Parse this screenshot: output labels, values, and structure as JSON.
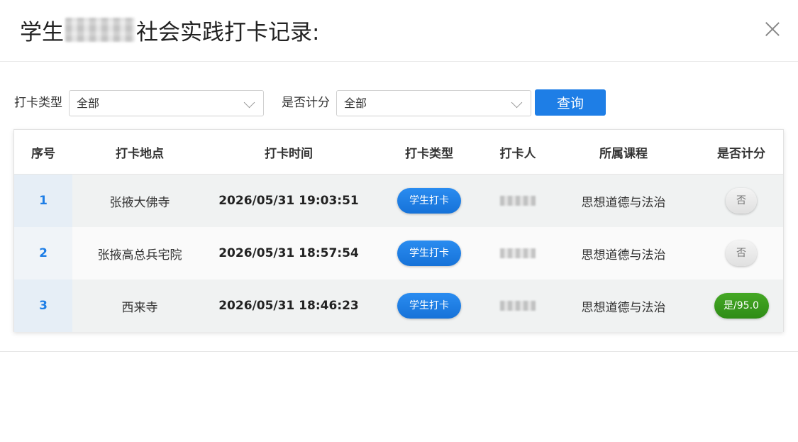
{
  "dialog": {
    "title_prefix": "学生",
    "title_suffix": "社会实践打卡记录:"
  },
  "filters": {
    "checkin_type_label": "打卡类型",
    "checkin_type_value": "全部",
    "scored_label": "是否计分",
    "scored_value": "全部",
    "query_button": "查询"
  },
  "table": {
    "headers": [
      "序号",
      "打卡地点",
      "打卡时间",
      "打卡类型",
      "打卡人",
      "所属课程",
      "是否计分"
    ],
    "rows": [
      {
        "seq": "1",
        "location": "张掖大佛寺",
        "time": "2026/05/31 19:03:51",
        "type": "学生打卡",
        "course": "思想道德与法治",
        "scored": "否"
      },
      {
        "seq": "2",
        "location": "张掖高总兵宅院",
        "time": "2026/05/31 18:57:54",
        "type": "学生打卡",
        "course": "思想道德与法治",
        "scored": "否"
      },
      {
        "seq": "3",
        "location": "西来寺",
        "time": "2026/05/31 18:46:23",
        "type": "学生打卡",
        "course": "思想道德与法治",
        "scored": "是/95.0"
      }
    ]
  },
  "colors": {
    "primary": "#1e7ee6",
    "success": "#3a9a1e",
    "neutral_tag": "#e8e8e8"
  }
}
